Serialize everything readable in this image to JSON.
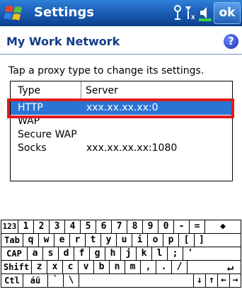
{
  "titlebar": {
    "title": "Settings",
    "ok_label": "ok",
    "icons": [
      "windows-start-icon",
      "connectivity-icon",
      "signal-icon",
      "speaker-icon"
    ]
  },
  "header": {
    "title": "My Work Network"
  },
  "instruction": "Tap a proxy type to change its settings.",
  "list": {
    "columns": [
      "Type",
      "Server"
    ],
    "rows": [
      {
        "type": "HTTP",
        "server": "xxx.xx.xx.xx:0",
        "selected": true
      },
      {
        "type": "WAP",
        "server": ""
      },
      {
        "type": "Secure WAP",
        "server": ""
      },
      {
        "type": "Socks",
        "server": "xxx.xx.xx.xx:1080"
      }
    ]
  },
  "keyboard": {
    "rows": [
      [
        "123",
        "1",
        "2",
        "3",
        "4",
        "5",
        "6",
        "7",
        "8",
        "9",
        "0",
        "-",
        "=",
        "◆"
      ],
      [
        "Tab",
        "q",
        "w",
        "e",
        "r",
        "t",
        "y",
        "u",
        "i",
        "o",
        "p",
        "[",
        "]"
      ],
      [
        "CAP",
        "a",
        "s",
        "d",
        "f",
        "g",
        "h",
        "j",
        "k",
        "l",
        ";",
        "'"
      ],
      [
        "Shift",
        "z",
        "x",
        "c",
        "v",
        "b",
        "n",
        "m",
        ",",
        ".",
        "/",
        "↵"
      ],
      [
        "Ctl",
        "áü",
        "`",
        "\\",
        " ",
        "↓",
        "↑",
        "←",
        "→"
      ]
    ]
  },
  "colors": {
    "title_bar": "#1c5fb8",
    "selection": "#2a74d4",
    "highlight_outline": "#e01a1a"
  }
}
